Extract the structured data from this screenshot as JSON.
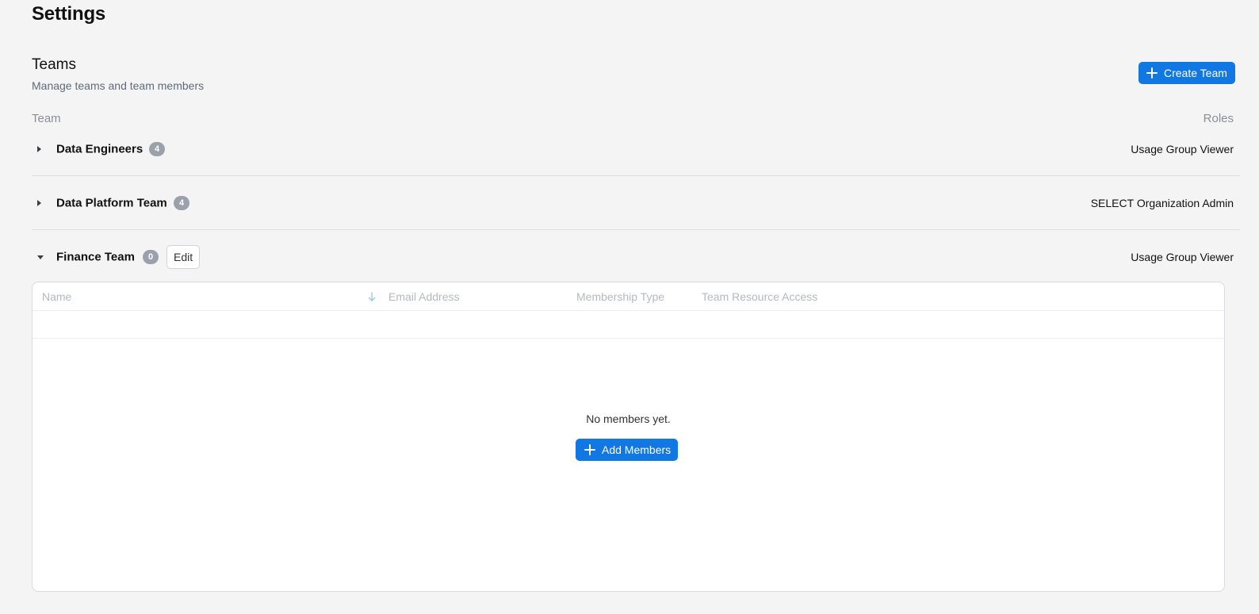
{
  "page": {
    "title": "Settings"
  },
  "teams_section": {
    "title": "Teams",
    "subtitle": "Manage teams and team members",
    "create_button_label": "Create Team",
    "column_team": "Team",
    "column_roles": "Roles"
  },
  "teams": [
    {
      "name": "Data Engineers",
      "member_count": "4",
      "role": "Usage Group Viewer",
      "expanded": false
    },
    {
      "name": "Data Platform Team",
      "member_count": "4",
      "role": "SELECT Organization Admin",
      "expanded": false
    },
    {
      "name": "Finance Team",
      "member_count": "0",
      "role": "Usage Group Viewer",
      "expanded": true,
      "edit_label": "Edit"
    }
  ],
  "members_table": {
    "columns": [
      "Name",
      "Email Address",
      "Membership Type",
      "Team Resource Access"
    ],
    "sorted_column": "Name",
    "sort_direction": "descending",
    "empty_text": "No members yet.",
    "add_button_label": "Add Members"
  },
  "colors": {
    "accent": "#1177e3",
    "badge": "#9aa1ab",
    "background": "#f4f4f4"
  },
  "icons": {
    "create_team": "plus-icon",
    "add_members": "plus-icon",
    "sort": "arrow-down-icon",
    "collapsed": "caret-right-icon",
    "expanded": "caret-down-icon"
  }
}
